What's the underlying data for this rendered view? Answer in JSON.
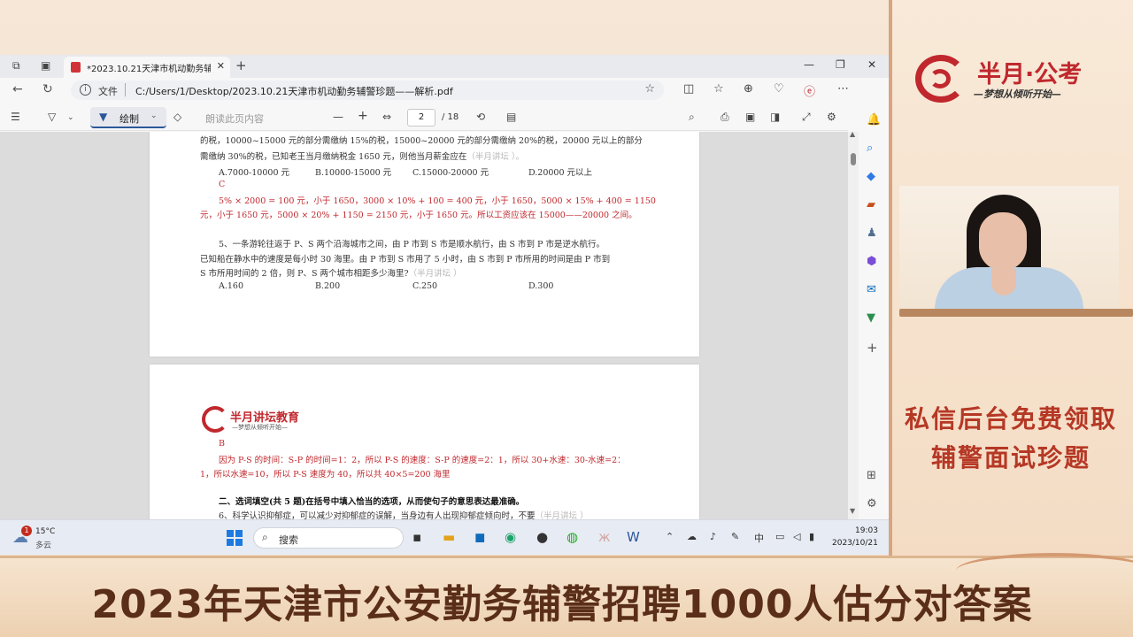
{
  "browser": {
    "tab_title": "*2023.10.21天津市机动勤务辅警",
    "address_label": "文件",
    "address_path": "C:/Users/1/Desktop/2023.10.21天津市机动勤务辅警珍题——解析.pdf"
  },
  "pdf_toolbar": {
    "draw_label": "绘制",
    "read_aloud_label": "朗读此页内容",
    "page_current": "2",
    "page_total": "/ 18"
  },
  "document": {
    "page1": {
      "line_top1": "的税，10000~15000 元的部分需缴纳 15%的税，15000~20000 元的部分需缴纳 20%的税，20000 元以上的部分",
      "line_top2": "需缴纳 30%的税，已知老王当月缴纳税金 1650 元，则他当月薪金应在",
      "blank1": "（半月讲坛    ）。",
      "q4_options": [
        "A.7000-10000 元",
        "B.10000-15000 元",
        "C.15000-20000 元",
        "D.20000 元以上"
      ],
      "q4_answer": "C",
      "q4_expl1": "5% × 2000 = 100 元，小于 1650，3000 × 10% + 100 = 400 元，小于 1650，5000 × 15% + 400 = 1150",
      "q4_expl2": "元，小于 1650 元，5000 × 20% + 1150 = 2150 元，小于 1650 元。所以工资应该在 15000——20000 之间。",
      "q5_line1": "5、一条游轮往返于 P、S 两个沿海城市之间，由 P 市到 S 市是顺水航行，由 S 市到 P 市是逆水航行。",
      "q5_line2": "已知船在静水中的速度是每小时 30 海里。由 P 市到 S 市用了 5 小时，由 S 市到 P 市所用的时间是由 P 市到",
      "q5_line3": "S 市所用时间的 2 倍，则 P、S 两个城市相距多少海里?",
      "blank2": "（半月讲坛    ）",
      "q5_options": [
        "A.160",
        "B.200",
        "C.250",
        "D.300"
      ]
    },
    "page2": {
      "logo_name": "半月讲坛教育",
      "logo_slogan": "—梦想从倾听开始—",
      "answer": "B",
      "expl1": "因为 P-S 的时间：S-P 的时间=1：2，所以 P-S 的速度：S-P 的速度=2：1，所以 30+水速：30-水速=2：",
      "expl2": "1，所以水速=10，所以 P-S 速度为 40，所以共 40×5=200 海里",
      "section_title": "二、选词填空(共 5 题)在括号中填入恰当的选项，从而使句子的意思表达最准确。",
      "q6_partial": "6、科学认识抑郁症，可以减少对抑郁症的误解，当身边有人出现抑郁症倾向时，不要",
      "blank3": "（半月讲坛    ）"
    }
  },
  "taskbar": {
    "weather_temp": "15°C",
    "weather_desc": "多云",
    "weather_badge": "1",
    "search_placeholder": "搜索",
    "ime": "中",
    "time": "19:03",
    "date": "2023/10/21"
  },
  "brand": {
    "name": "半月·公考",
    "slogan": "—梦想从倾听开始—",
    "promo_line1": "私信后台免费领取",
    "promo_line2": "辅警面试珍题"
  },
  "banner": {
    "text": "2023年天津市公安勤务辅警招聘1000人估分对答案"
  },
  "colors": {
    "brand_red": "#c0282d",
    "answer_red": "#c0282d",
    "promo": "#b53825",
    "banner_text": "#5a2e18"
  }
}
